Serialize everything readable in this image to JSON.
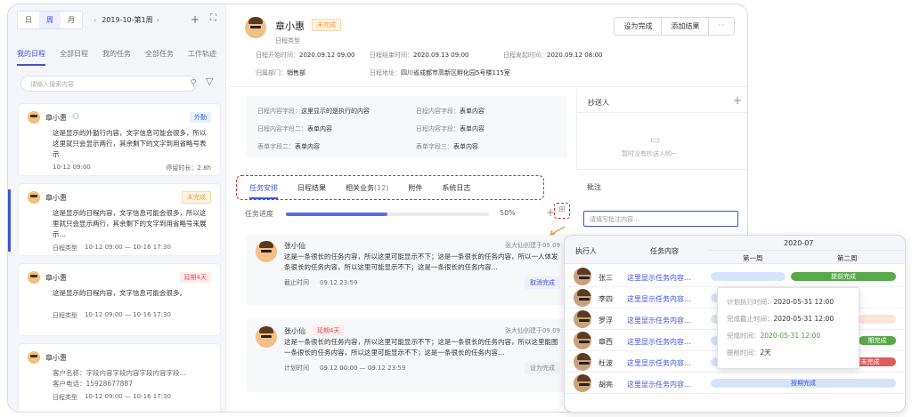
{
  "left": {
    "view_modes": [
      "日",
      "周",
      "月"
    ],
    "date_label": "2019-10-第1周",
    "tabs": [
      "我的日程",
      "全部日程",
      "我的任务",
      "全部任务",
      "工作轨迹"
    ],
    "search_placeholder": "请输入搜索内容",
    "cards": [
      {
        "name": "章小惠",
        "badge": "外勤",
        "text": "这是显示的外勤行内容，文字信息可能会很多，所以这里就只会显示两行，其余剩下的文字到用省略号表示",
        "date": "10-12 09:00",
        "extra": "停留时长：2.8h"
      },
      {
        "name": "章小惠",
        "badge": "未完成",
        "text": "这是显示的日程内容，文字信息可能会很多，所以这里就只会显示两行，其余剩下的文字到用省略号来展示…",
        "label": "日程类型",
        "range": "10-12 09:00 — 10-16 17:30"
      },
      {
        "name": "章小惠",
        "badge": "延期4天",
        "text": "这是显示的日程内容，文字信息可能会很多。",
        "label": "日程类型",
        "range": "10-12 09:00 — 10-16 17:30"
      },
      {
        "name": "章小惠",
        "line1": "客户名称：字段内容字段内容字段内容字段…",
        "line2": "客户电话：15928677887",
        "label": "日程类型",
        "range": "10-12 09:00 — 10-16 17:30"
      }
    ]
  },
  "header": {
    "name": "章小惠",
    "status": "未完成",
    "type": "日程类型",
    "btn_complete": "设为完成",
    "btn_result": "添加结果",
    "btn_more": "···",
    "start_label": "日程开始时间：",
    "start": "2020.09.12 09:00",
    "end_label": "日程结束时间：",
    "end": "2020.09.13 09:00",
    "sent_label": "日程发起时间：",
    "sent": "2020.09.12 08:00",
    "dept_label": "归属部门：",
    "dept": "销售部",
    "addr_label": "日程地址：",
    "addr": "四川省成都市高新区孵化园5号楼115室"
  },
  "fields": [
    {
      "label": "日程内容字段：",
      "value": "这里显示的是执行的内容"
    },
    {
      "label": "日程内容字段：",
      "value": "表单内容"
    },
    {
      "label": "日程内容字段二：",
      "value": "表单内容"
    },
    {
      "label": "日程内容字段：",
      "value": "表单内容"
    },
    {
      "label": "表单字段二：",
      "value": "表单内容"
    },
    {
      "label": "表单字段三：",
      "value": "表单内容"
    }
  ],
  "cc": {
    "title": "抄送人",
    "empty": "暂时没有抄送人哟~"
  },
  "notes": {
    "title": "批注",
    "placeholder": "请填写批注内容..."
  },
  "detail_tabs": [
    "任务安排",
    "日程结果",
    "相关业务",
    "附件",
    "系统日志"
  ],
  "related_count": "(12)",
  "progress": {
    "label": "任务进度",
    "value": 50,
    "text": "50%"
  },
  "tasks": [
    {
      "name": "张小仙",
      "creator": "张大仙创建于09.09",
      "text": "这是一条很长的任务内容，所以这里可能显示不下；这是一条很长的任务内容，所以一人体发条很长的任务内容，所以这里可能显示不下；这是一条很长的任务内容…",
      "due_label": "截止时间",
      "due": "09.12  23:59",
      "action": "取消完成"
    },
    {
      "name": "张小仙",
      "delay": "延期4天",
      "creator": "张大仙创建于09.09",
      "text": "这是一条很长的任务内容，所以这里可能显示不下；这是一条很长的任务内容，所以这里能图一条很长的任务内容，所以这里可能显示不下；这是一条很长的任务内容…",
      "due_label": "计划时间",
      "due": "09.12 00:00  —  09.12 23:59",
      "action": "设为完成"
    }
  ],
  "gantt": {
    "col_person": "执行人",
    "col_task": "任务内容",
    "month": "2020-07",
    "weeks": [
      "第一周",
      "第二周"
    ],
    "rows": [
      {
        "person": "张三",
        "task": "这里显示任务内容…",
        "bar": "提前完成"
      },
      {
        "person": "李四",
        "task": "这里显示任务内容…",
        "bar": ""
      },
      {
        "person": "罗浮",
        "task": "这里显示任务内容…",
        "bar": ""
      },
      {
        "person": "章西",
        "task": "这里显示任务内容…",
        "bar": "期完成"
      },
      {
        "person": "杜波",
        "task": "这里显示任务内容…",
        "bar": "延时未完成"
      },
      {
        "person": "胡亮",
        "task": "这里显示任务内容…",
        "bar": "按期完成"
      }
    ],
    "tooltip": {
      "plan_label": "计划执行时间：",
      "plan": "2020-05-31 12:00",
      "due_label": "完成截止时间：",
      "due": "2020-05-31 12:00",
      "done_label": "完成时间：",
      "done": "2020-05-31 12:00",
      "early_label": "提前时间：",
      "early": "2天"
    },
    "colors": {
      "green": "#5aa84c",
      "red": "#e05c5c",
      "blue": "#d6e4fb",
      "orange": "#fde3d8"
    }
  }
}
